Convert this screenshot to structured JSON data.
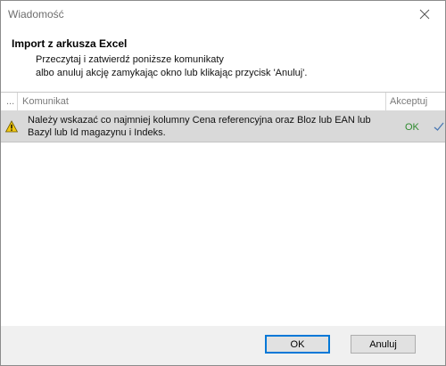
{
  "window": {
    "title": "Wiadomość",
    "close_icon": "close-icon"
  },
  "header": {
    "title": "Import z arkusza Excel",
    "line1": "Przeczytaj i zatwierdź poniższe komunikaty",
    "line2": "albo anuluj akcję zamykając okno lub klikając przycisk 'Anuluj'."
  },
  "grid": {
    "columns": [
      "...",
      "Komunikat",
      "Akceptuj"
    ],
    "rows": [
      {
        "icon": "warning-icon",
        "message": "Należy wskazać co najmniej kolumny Cena referencyjna oraz Bloz lub EAN lub Bazyl lub Id magazynu i Indeks.",
        "status": "OK",
        "status_color": "#2e8b2e",
        "accepted": true
      }
    ]
  },
  "footer": {
    "ok_label": "OK",
    "cancel_label": "Anuluj"
  },
  "colors": {
    "accent": "#0078d7",
    "warning": "#f2c811",
    "row_selected": "#d9d9d9"
  }
}
